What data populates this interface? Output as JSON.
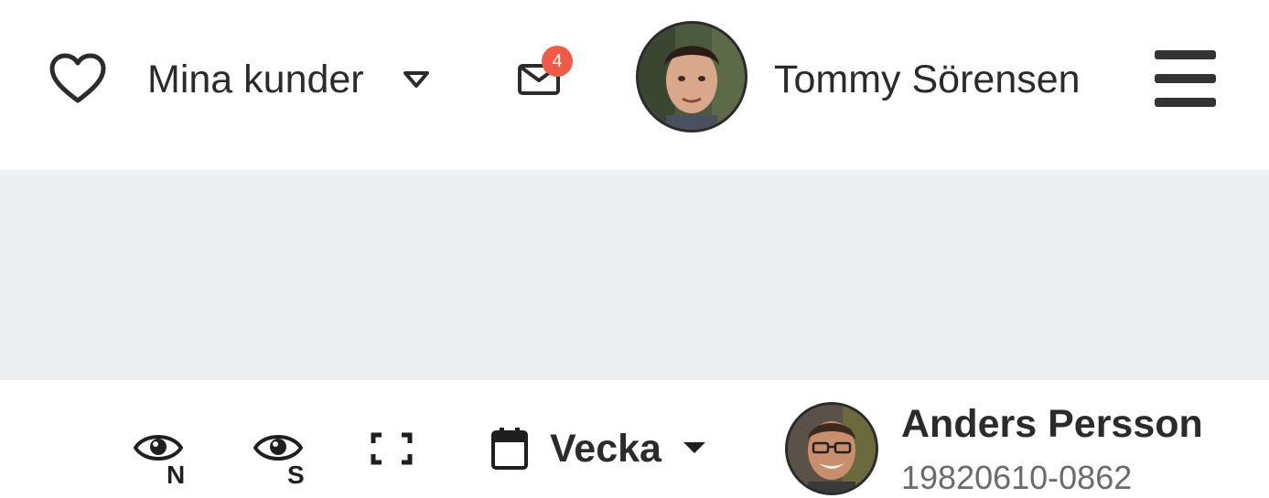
{
  "header": {
    "favorites_icon": "heart-outline-icon",
    "customers_label": "Mina kunder",
    "customers_dropdown_icon": "chevron-down-outline-icon",
    "messages_icon": "envelope-icon",
    "messages_badge": "4",
    "user_name": "Tommy Sörensen",
    "menu_icon": "hamburger-icon"
  },
  "toolbar": {
    "view_n_letter": "N",
    "view_s_letter": "S",
    "fullscreen_icon": "fullscreen-icon",
    "calendar_icon": "calendar-icon",
    "period_label": "Vecka",
    "period_dropdown_icon": "caret-down-icon",
    "customer_name": "Anders Persson",
    "customer_id": "19820610-0862"
  },
  "colors": {
    "header_bg": "#ffffff",
    "toolbar_bg": "#ebeff0",
    "badge_bg": "#f05a47",
    "text_primary": "#2b2b2b",
    "text_secondary": "#6b6b6b"
  }
}
